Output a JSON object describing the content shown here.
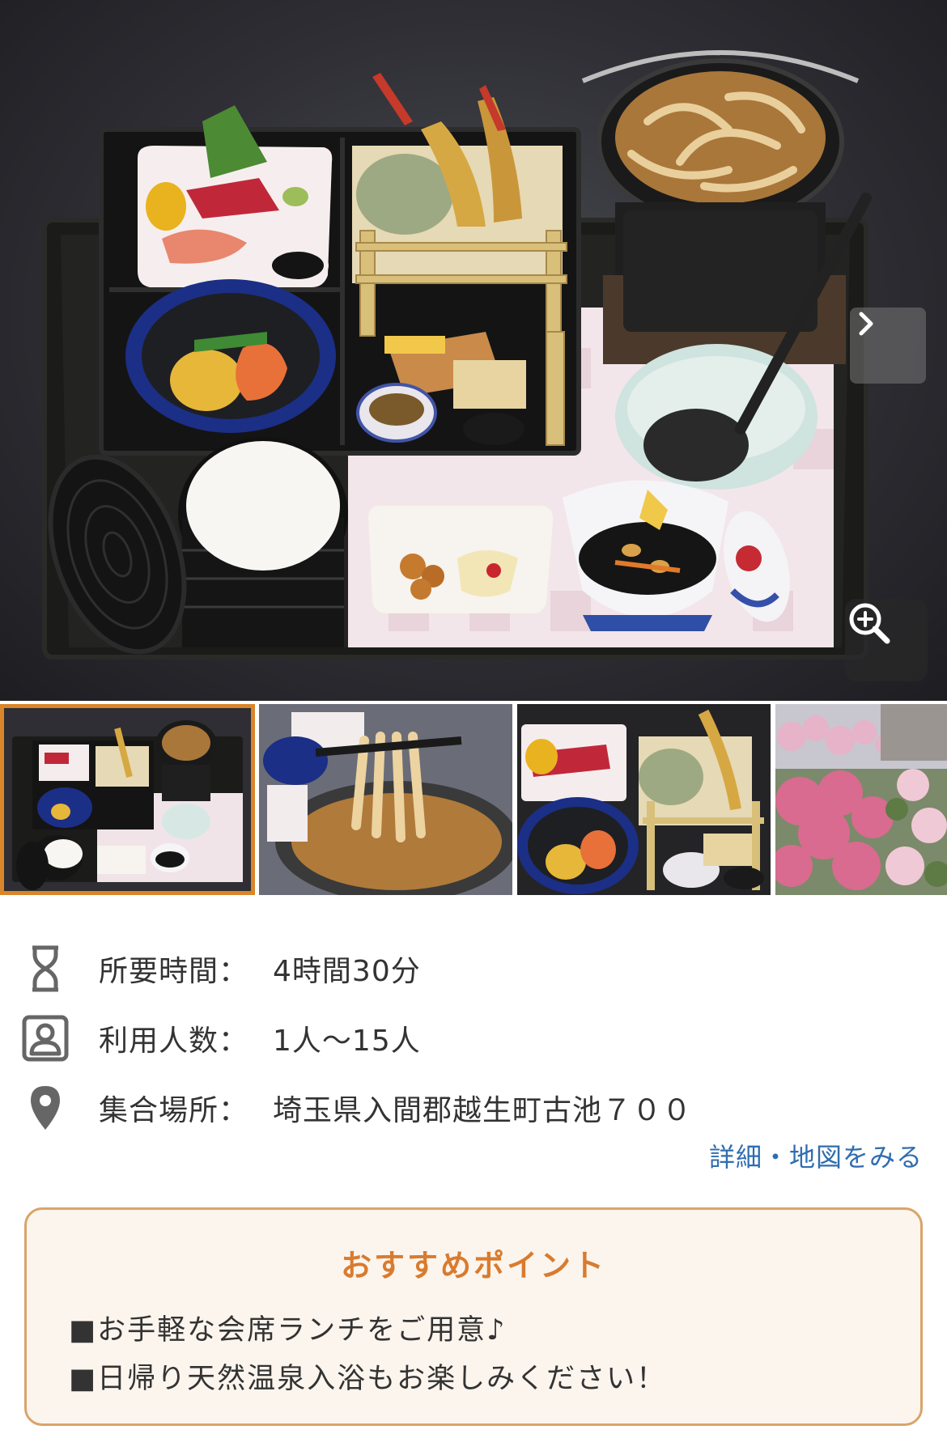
{
  "gallery": {
    "main_alt": "food-photo",
    "next_icon": "chevron-right-icon",
    "zoom_icon": "zoom-in-icon",
    "active_thumb_color": "#d9852a",
    "thumbnails": [
      "thumb-set-meal",
      "thumb-udon-lift",
      "thumb-bento-closeup",
      "thumb-azalea-garden"
    ]
  },
  "details": {
    "duration_label": "所要時間：",
    "duration_value": "4時間30分",
    "people_label": "利用人数：",
    "people_value": "1人〜15人",
    "place_label": "集合場所：",
    "place_value": "埼玉県入間郡越生町古池７００",
    "map_link": "詳細・地図をみる"
  },
  "recommend": {
    "title": "おすすめポイント",
    "points": [
      "■お手軽な会席ランチをご用意♪",
      "■日帰り天然温泉入浴もお楽しみください！"
    ],
    "accent_color": "#d97b2e",
    "border_color": "#d9a46a",
    "background": "#fcf5ee"
  },
  "link_color": "#2f6db0"
}
